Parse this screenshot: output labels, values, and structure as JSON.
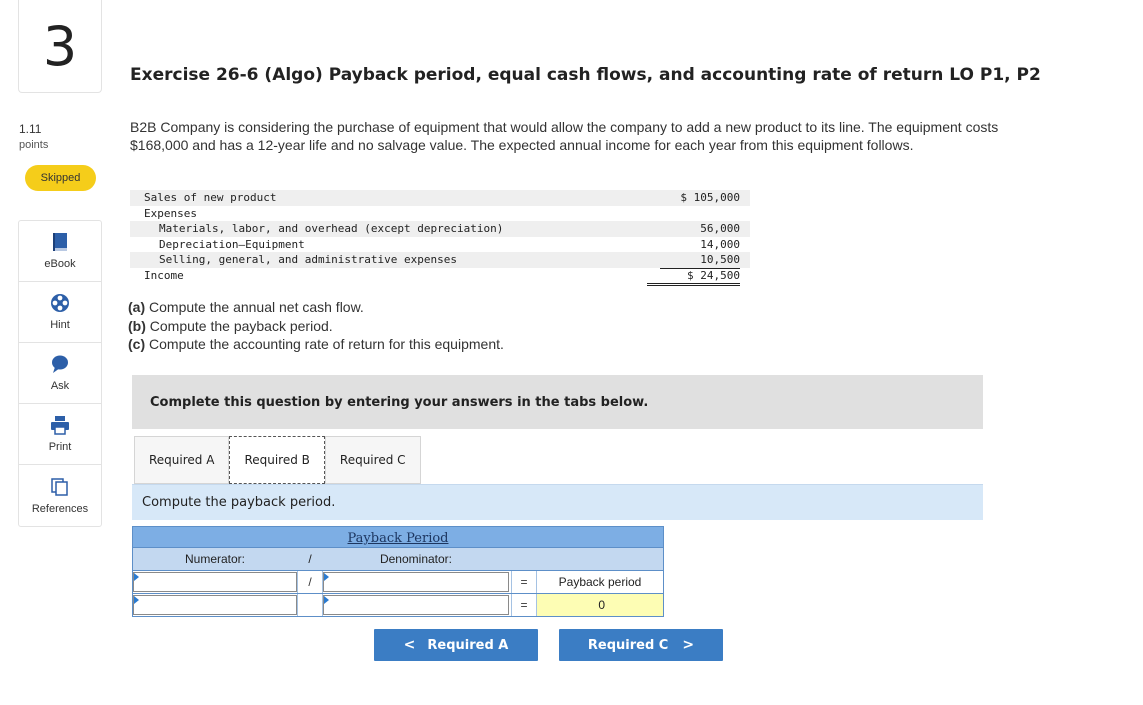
{
  "question": {
    "number": "3",
    "points_value": "1.11",
    "points_label": "points",
    "status": "Skipped"
  },
  "tools": [
    {
      "label": "eBook",
      "icon": "book-icon"
    },
    {
      "label": "Hint",
      "icon": "hint-icon"
    },
    {
      "label": "Ask",
      "icon": "chat-bubble-icon"
    },
    {
      "label": "Print",
      "icon": "printer-icon"
    },
    {
      "label": "References",
      "icon": "references-icon"
    }
  ],
  "exercise": {
    "title": "Exercise 26-6 (Algo) Payback period, equal cash flows, and accounting rate of return LO P1, P2",
    "intro": "B2B Company is considering the purchase of equipment that would allow the company to add a new product to its line. The equipment costs $168,000 and has a 12-year life and no salvage value. The expected annual income for each year from this equipment follows."
  },
  "statement": {
    "sales_label": "Sales of new product",
    "sales_amount": "$ 105,000",
    "expenses_label": "Expenses",
    "materials_label": "Materials, labor, and overhead (except depreciation)",
    "materials_amount": "56,000",
    "depreciation_label": "Depreciation—Equipment",
    "depreciation_amount": "14,000",
    "selling_label": "Selling, general, and administrative expenses",
    "selling_amount": "10,500",
    "income_label": "Income",
    "income_amount": "$ 24,500"
  },
  "parts": {
    "a_tag": "(a)",
    "a_text": " Compute the annual net cash flow.",
    "b_tag": "(b)",
    "b_text": " Compute the payback period.",
    "c_tag": "(c)",
    "c_text": " Compute the accounting rate of return for this equipment."
  },
  "instructions": "Complete this question by entering your answers in the tabs below.",
  "tabs": [
    "Required A",
    "Required B",
    "Required C"
  ],
  "active_tab": "Required B",
  "task_prompt": "Compute the payback period.",
  "payback_table": {
    "title": "Payback Period",
    "numerator_label": "Numerator:",
    "divider": "/",
    "denominator_label": "Denominator:",
    "equals": "=",
    "result_label": "Payback period",
    "result_value": "0"
  },
  "nav": {
    "prev_label": "Required A",
    "prev_chevron": "<",
    "next_label": "Required C",
    "next_chevron": ">"
  }
}
